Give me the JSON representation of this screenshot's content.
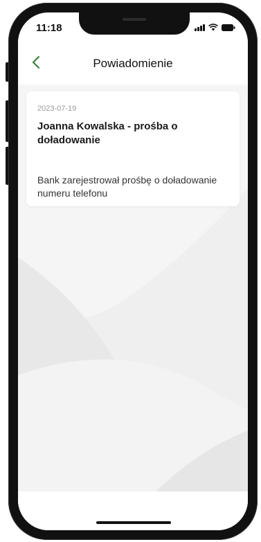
{
  "status_bar": {
    "time": "11:18",
    "icons": [
      "signal-icon",
      "wifi-icon",
      "battery-icon"
    ]
  },
  "header": {
    "back_icon": "chevron-left-icon",
    "title": "Powiadomienie"
  },
  "notification": {
    "date": "2023-07-19",
    "title": "Joanna Kowalska - prośba o doładowanie",
    "body": "Bank zarejestrował prośbę o doładowanie numeru telefonu"
  },
  "colors": {
    "accent": "#2e7d32",
    "background": "#efefef",
    "card": "#ffffff"
  }
}
